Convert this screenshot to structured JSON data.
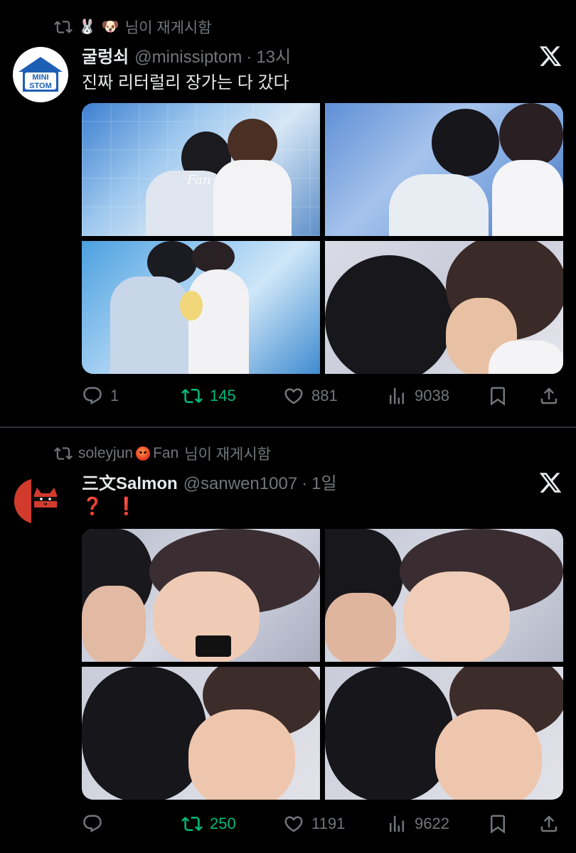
{
  "tweets": [
    {
      "social_context": {
        "emojis": [
          "🐰",
          "🐶"
        ],
        "text": "님이 재게시함"
      },
      "avatar": {
        "logo_line1": "MINI",
        "logo_line2": "STOM"
      },
      "display_name": "굴렁쇠",
      "handle": "@minissiptom",
      "separator": "·",
      "time": "13시",
      "text": "진짜 리터럴리 장가는 다 갔다",
      "media_count": 4,
      "actions": {
        "replies": "1",
        "retweets": "145",
        "likes": "881",
        "views": "9038"
      }
    },
    {
      "social_context": {
        "user": "soleyjun",
        "suffix": "Fan",
        "text": "님이 재게시함"
      },
      "display_name": "三文Salmon",
      "handle": "@sanwen1007",
      "separator": "·",
      "time": "1일",
      "text": "❓❗",
      "media_count": 4,
      "actions": {
        "replies": "",
        "retweets": "250",
        "likes": "1191",
        "views": "9622"
      }
    }
  ],
  "media_watermark": "Fan",
  "colors": {
    "background": "#000000",
    "primary_text": "#e7e9ea",
    "secondary_text": "#71767b",
    "retweet_green": "#00ba7c",
    "divider": "#2f3336",
    "accent_red": "#e0245e"
  },
  "icons": [
    "repost-icon",
    "reply-icon",
    "like-icon",
    "views-icon",
    "bookmark-icon",
    "share-icon",
    "x-logo-icon"
  ]
}
